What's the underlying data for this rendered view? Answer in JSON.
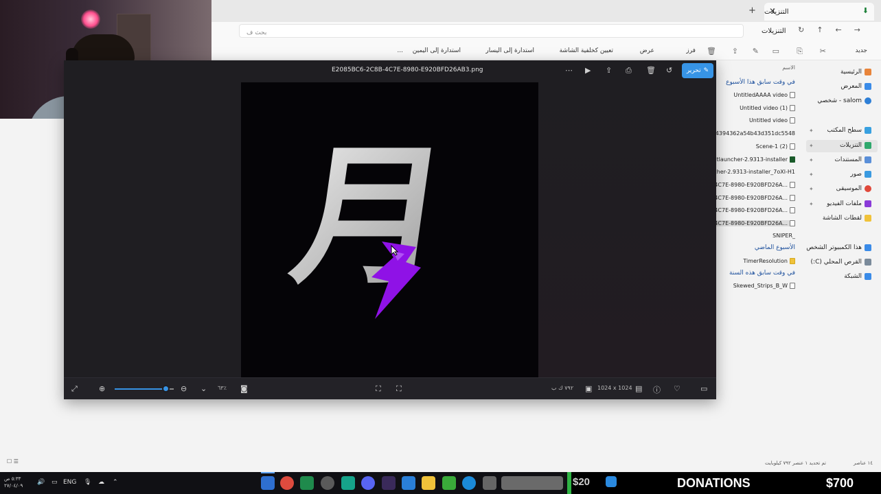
{
  "explorer": {
    "tab_title": "التنزيلات",
    "search_placeholder": "بحث ف",
    "breadcrumb": "التنزيلات",
    "toolbar": {
      "new": "جديد",
      "sort": "فرز",
      "view": "عرض",
      "set_background": "تعيين كخلفية الشاشة",
      "rotate_left": "استدارة إلى اليسار",
      "rotate_right": "استدارة إلى اليمين",
      "more": "..."
    },
    "sidebar": {
      "items": [
        {
          "label": "الرئيسية",
          "icon": "home-icon"
        },
        {
          "label": "المعرض",
          "icon": "gallery-icon"
        },
        {
          "label": "salom - شخصي",
          "icon": "onedrive-icon"
        },
        {
          "label": "سطح المكتب",
          "icon": "desktop-icon"
        },
        {
          "label": "التنزيلات",
          "icon": "download-icon"
        },
        {
          "label": "المستندات",
          "icon": "documents-icon"
        },
        {
          "label": "صور",
          "icon": "pictures-icon"
        },
        {
          "label": "الموسيقى",
          "icon": "music-icon"
        },
        {
          "label": "ملفات الفيديو",
          "icon": "videos-icon"
        },
        {
          "label": "لقطات الشاشة",
          "icon": "folder-icon"
        },
        {
          "label": "هذا الكمبيوتر الشخص",
          "icon": "this-pc-icon"
        },
        {
          "label": "القرص المحلي (C:)",
          "icon": "drive-icon"
        },
        {
          "label": "الشبكة",
          "icon": "network-icon"
        }
      ]
    },
    "filelist": {
      "column_header": "الاسم",
      "groups": {
        "earlier_this_week": "في وقت سابق هذا الأسبوع",
        "last_week": "الأسبوع الماضي",
        "earlier_this_year": "في وقت سابق هذه السنة"
      },
      "files_week": [
        "UntitledAAAA video",
        "Untitled video (1)",
        "Untitled video",
        "e74394362a54b43d351dc5548",
        "Scene-1 (2)",
        "tlauncher-2.9313-installer",
        "cher-2.9313-installer_7oXl-H1",
        "8B-4C7E-8980-E920BFD26A...",
        "8B-4C7E-8980-E920BFD26A...",
        "8B-4C7E-8980-E920BFD26A...",
        "8B-4C7E-8980-E920BFD26A...",
        "SNIPER_"
      ],
      "files_lastweek": [
        "TimerResolution"
      ],
      "files_year": [
        "Skewed_Strips_B_W"
      ]
    },
    "status": {
      "count": "١٤ عناصر",
      "selected": "تم تحديد ١ عنصر ٧٩٢ كيلوبايت"
    }
  },
  "photos": {
    "filename": "E2085BC6-2C8B-4C7E-8980-E920BFD26AB3.png",
    "edit_label": "تحرير",
    "zoom_percent": "٦٣٪",
    "zoom_level": 0.86,
    "file_size": "٧٩٢ ك ب",
    "dimensions": "1024 x 1024",
    "image_glyph": "月"
  },
  "taskbar": {
    "time": "٥:٣٣ ص",
    "date": "٢٧/٠٤/٠٩",
    "language": "ENG",
    "donation_left": "$20",
    "donation_label": "DONATIONS",
    "donation_right": "$700"
  },
  "colors": {
    "accent": "#3794e6",
    "viewer_bg": "#1f1e22",
    "bolt": "#8f12e6",
    "taskbar": "#101014"
  }
}
